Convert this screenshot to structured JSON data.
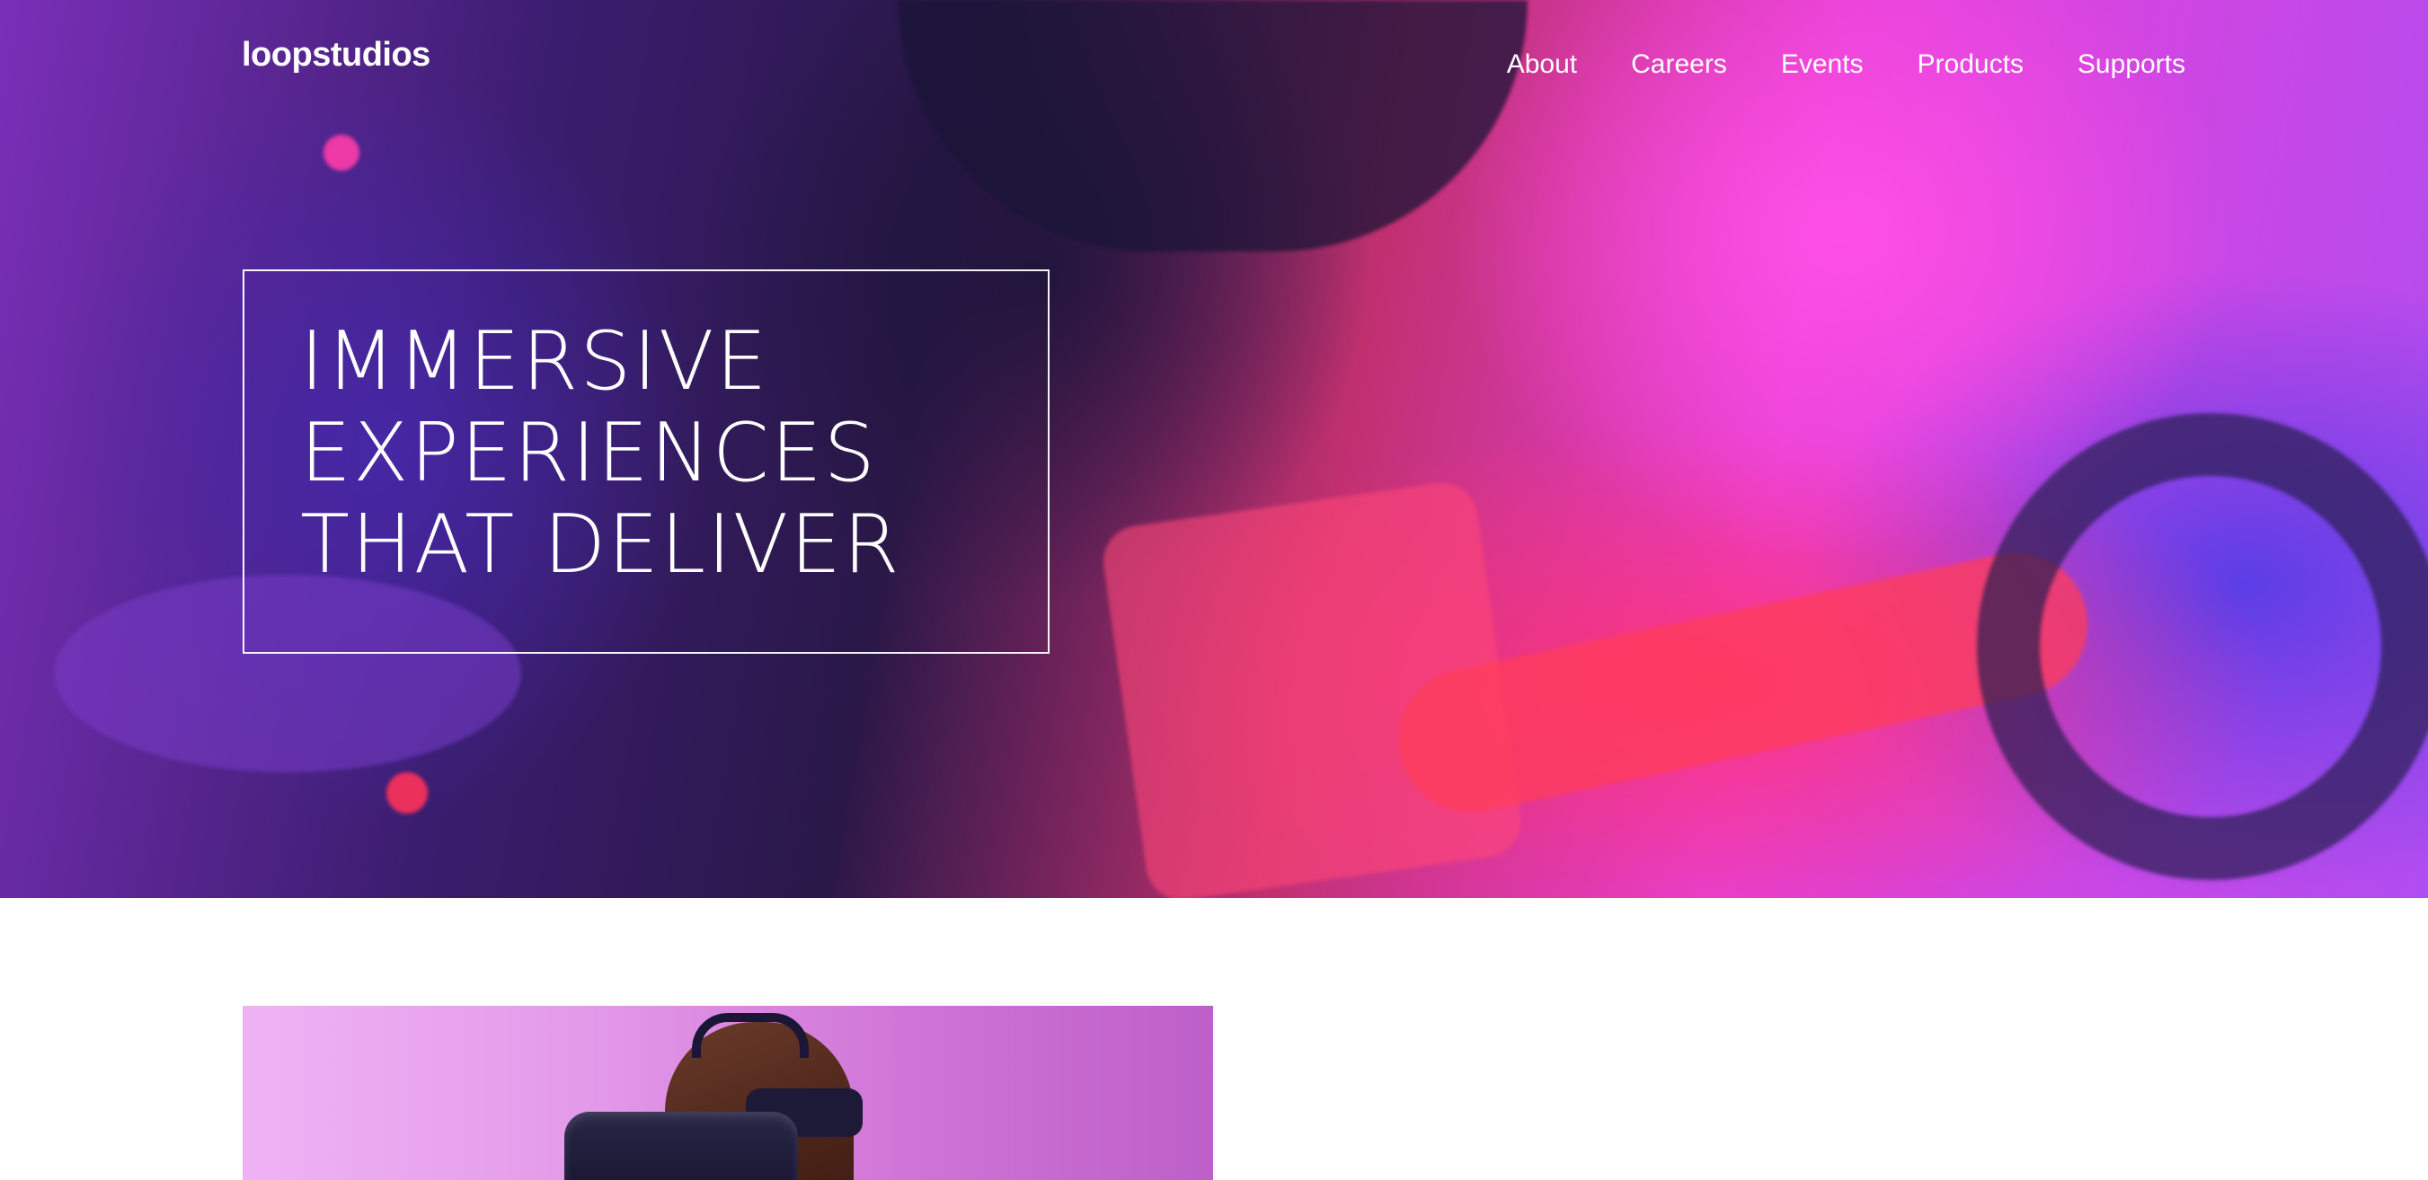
{
  "header": {
    "logo": "loopstudios",
    "nav": [
      {
        "label": "About"
      },
      {
        "label": "Careers"
      },
      {
        "label": "Events"
      },
      {
        "label": "Products"
      },
      {
        "label": "Supports"
      }
    ]
  },
  "hero": {
    "headline_lines": [
      "IMMERSIVE",
      "EXPERIENCES",
      "THAT DELIVER"
    ]
  },
  "colors": {
    "text_on_hero": "#ffffff",
    "page_background": "#ffffff"
  }
}
